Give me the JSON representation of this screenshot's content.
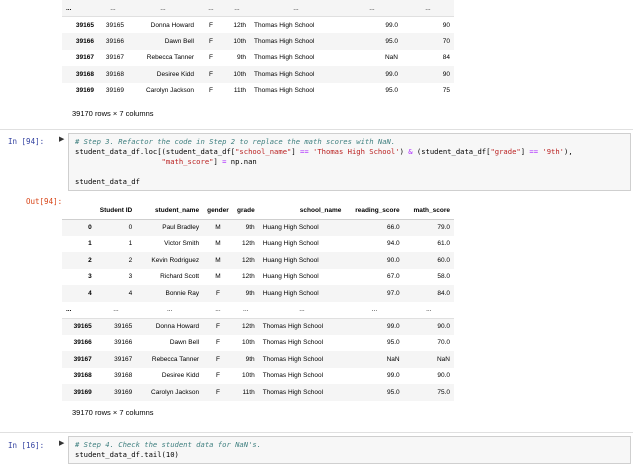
{
  "top_table": {
    "rows": [
      {
        "idx": "...",
        "student_id": "...",
        "name": "...",
        "gender": "...",
        "grade": "...",
        "school": "...",
        "reading": "...",
        "math": "..."
      },
      {
        "idx": "39165",
        "student_id": "39165",
        "name": "Donna Howard",
        "gender": "F",
        "grade": "12th",
        "school": "Thomas High School",
        "reading": "99.0",
        "math": "90"
      },
      {
        "idx": "39166",
        "student_id": "39166",
        "name": "Dawn Bell",
        "gender": "F",
        "grade": "10th",
        "school": "Thomas High School",
        "reading": "95.0",
        "math": "70"
      },
      {
        "idx": "39167",
        "student_id": "39167",
        "name": "Rebecca Tanner",
        "gender": "F",
        "grade": "9th",
        "school": "Thomas High School",
        "reading": "NaN",
        "math": "84"
      },
      {
        "idx": "39168",
        "student_id": "39168",
        "name": "Desiree Kidd",
        "gender": "F",
        "grade": "10th",
        "school": "Thomas High School",
        "reading": "99.0",
        "math": "90"
      },
      {
        "idx": "39169",
        "student_id": "39169",
        "name": "Carolyn Jackson",
        "gender": "F",
        "grade": "11th",
        "school": "Thomas High School",
        "reading": "95.0",
        "math": "75"
      }
    ],
    "shape": "39170 rows × 7 columns"
  },
  "cell94": {
    "prompt": "In [94]:",
    "comment": "# Step 3. Refactor the code in Step 2 to replace the math scores with NaN.",
    "line1_a": "student_data_df.loc[(student_data_df[",
    "str_school_name": "\"school_name\"",
    "line1_b": "] ",
    "op_eq1": "==",
    "line1_c": " ",
    "str_thomas": "'Thomas High School'",
    "line1_d": ") ",
    "op_and": "&",
    "line1_e": " (student_data_df[",
    "str_grade": "\"grade\"",
    "line1_f": "] ",
    "op_eq2": "==",
    "line1_g": " ",
    "str_9th": "'9th'",
    "line1_h": "),",
    "line2_indent": "                    ",
    "str_math_score": "\"math_score\"",
    "line2_b": "] ",
    "op_assign": "=",
    "line2_c": " np.nan",
    "line3": "student_data_df",
    "out_prompt": "Out[94]:"
  },
  "out_table": {
    "headers": [
      "",
      "Student ID",
      "student_name",
      "gender",
      "grade",
      "school_name",
      "reading_score",
      "math_score"
    ],
    "rows": [
      {
        "idx": "0",
        "student_id": "0",
        "name": "Paul Bradley",
        "gender": "M",
        "grade": "9th",
        "school": "Huang High School",
        "reading": "66.0",
        "math": "79.0"
      },
      {
        "idx": "1",
        "student_id": "1",
        "name": "Victor Smith",
        "gender": "M",
        "grade": "12th",
        "school": "Huang High School",
        "reading": "94.0",
        "math": "61.0"
      },
      {
        "idx": "2",
        "student_id": "2",
        "name": "Kevin Rodriguez",
        "gender": "M",
        "grade": "12th",
        "school": "Huang High School",
        "reading": "90.0",
        "math": "60.0"
      },
      {
        "idx": "3",
        "student_id": "3",
        "name": "Richard Scott",
        "gender": "M",
        "grade": "12th",
        "school": "Huang High School",
        "reading": "67.0",
        "math": "58.0"
      },
      {
        "idx": "4",
        "student_id": "4",
        "name": "Bonnie Ray",
        "gender": "F",
        "grade": "9th",
        "school": "Huang High School",
        "reading": "97.0",
        "math": "84.0"
      },
      {
        "idx": "...",
        "student_id": "...",
        "name": "...",
        "gender": "...",
        "grade": "...",
        "school": "...",
        "reading": "...",
        "math": "..."
      },
      {
        "idx": "39165",
        "student_id": "39165",
        "name": "Donna Howard",
        "gender": "F",
        "grade": "12th",
        "school": "Thomas High School",
        "reading": "99.0",
        "math": "90.0"
      },
      {
        "idx": "39166",
        "student_id": "39166",
        "name": "Dawn Bell",
        "gender": "F",
        "grade": "10th",
        "school": "Thomas High School",
        "reading": "95.0",
        "math": "70.0"
      },
      {
        "idx": "39167",
        "student_id": "39167",
        "name": "Rebecca Tanner",
        "gender": "F",
        "grade": "9th",
        "school": "Thomas High School",
        "reading": "NaN",
        "math": "NaN"
      },
      {
        "idx": "39168",
        "student_id": "39168",
        "name": "Desiree Kidd",
        "gender": "F",
        "grade": "10th",
        "school": "Thomas High School",
        "reading": "99.0",
        "math": "90.0"
      },
      {
        "idx": "39169",
        "student_id": "39169",
        "name": "Carolyn Jackson",
        "gender": "F",
        "grade": "11th",
        "school": "Thomas High School",
        "reading": "95.0",
        "math": "75.0"
      }
    ],
    "shape": "39170 rows × 7 columns"
  },
  "cell16": {
    "prompt": "In [16]:",
    "comment": "# Step 4. Check the student data for NaN's.",
    "code": "student_data_df.tail(10)"
  },
  "icons": {
    "run": "run-indicator-icon"
  },
  "colors": {
    "in_prompt": "#303f9f",
    "out_prompt": "#d84315",
    "comment": "#408080",
    "string": "#ba2121",
    "operator": "#aa22ff"
  }
}
